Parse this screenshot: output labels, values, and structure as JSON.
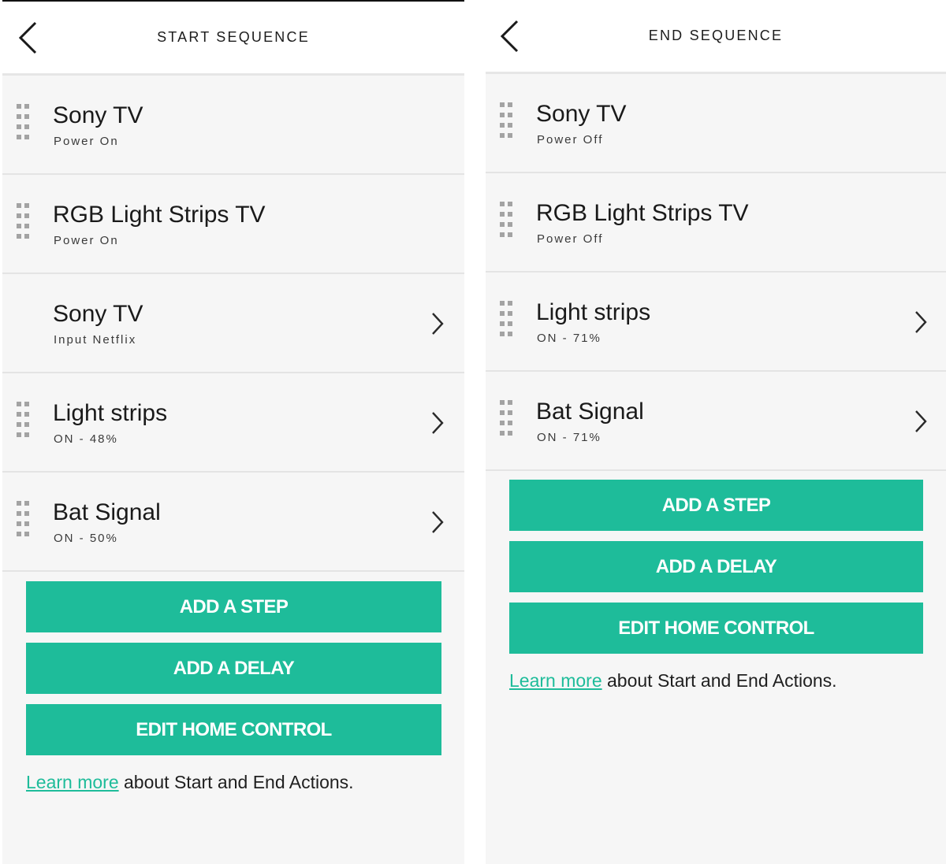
{
  "accent_color": "#1ebc9a",
  "panels": {
    "start": {
      "title": "START SEQUENCE",
      "back_icon": "chevron-left-icon",
      "steps": [
        {
          "name": "Sony TV",
          "detail": "Power On",
          "draggable": true,
          "has_chevron": false
        },
        {
          "name": "RGB Light Strips TV",
          "detail": "Power On",
          "draggable": true,
          "has_chevron": false
        },
        {
          "name": "Sony TV",
          "detail": "Input Netflix",
          "draggable": false,
          "has_chevron": true
        },
        {
          "name": "Light strips",
          "detail": "ON - 48%",
          "draggable": true,
          "has_chevron": true
        },
        {
          "name": "Bat Signal",
          "detail": "ON - 50%",
          "draggable": true,
          "has_chevron": true
        }
      ],
      "buttons": {
        "add_step": "ADD A STEP",
        "add_delay": "ADD A DELAY",
        "edit_home_control": "EDIT HOME CONTROL"
      },
      "learn_more": {
        "link": "Learn more",
        "text": " about Start and End Actions."
      }
    },
    "end": {
      "title": "END SEQUENCE",
      "back_icon": "chevron-left-icon",
      "steps": [
        {
          "name": "Sony TV",
          "detail": "Power Off",
          "draggable": true,
          "has_chevron": false
        },
        {
          "name": "RGB Light Strips TV",
          "detail": "Power Off",
          "draggable": true,
          "has_chevron": false
        },
        {
          "name": "Light strips",
          "detail": "ON - 71%",
          "draggable": true,
          "has_chevron": true
        },
        {
          "name": "Bat Signal",
          "detail": "ON - 71%",
          "draggable": true,
          "has_chevron": true
        }
      ],
      "buttons": {
        "add_step": "ADD A STEP",
        "add_delay": "ADD A DELAY",
        "edit_home_control": "EDIT HOME CONTROL"
      },
      "learn_more": {
        "link": "Learn more",
        "text": " about Start and End Actions."
      }
    }
  }
}
